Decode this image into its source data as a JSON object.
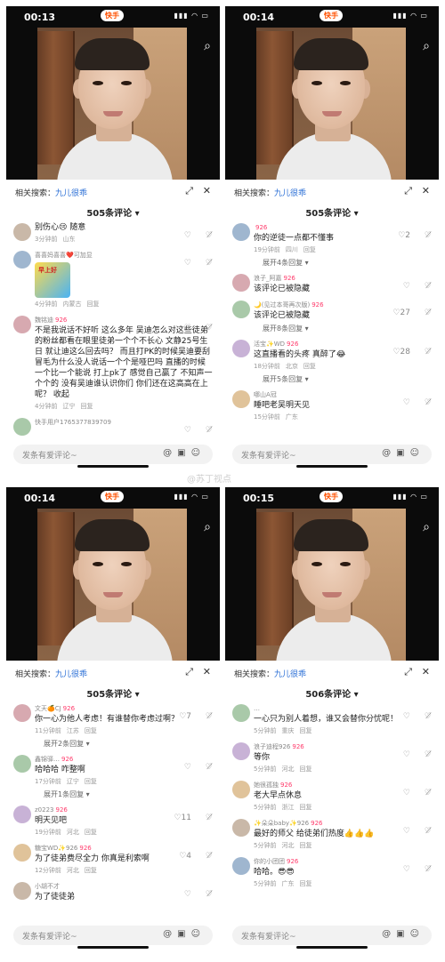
{
  "watermark": "@苏丁视点",
  "panels": [
    {
      "time": "00:13",
      "app": "快手",
      "related_label": "相关搜索：",
      "related_link": "九儿很乖",
      "count": "505条评论 ▾",
      "input_placeholder": "发条有爱评论~",
      "comments": [
        {
          "name": "",
          "badge": "",
          "text": "别伤心😢 随意",
          "meta": [
            "3分钟前",
            "山东"
          ],
          "like": ""
        },
        {
          "name": "喜喜妈喜喜❤️可加显",
          "badge": "",
          "text": "",
          "sticker": "早上好",
          "meta": [
            "4分钟前",
            "内蒙古",
            "回复"
          ],
          "like": ""
        },
        {
          "name": "魏铭迪",
          "badge": "926",
          "text": "不是我说话不好听 这么多年 吴迪怎么对这些徒弟的粉丝都看在眼里徒弟一个个不长心 文静25号生日 就让迪这么回去吗？ 而且打PK的时候吴迪要刮冒毛为什么没人说话一个个是哑巴吗 直播的时候一个比一个能说 打上pk了 感觉自己赢了 不知声一个个的 没有吴迪谁认识你们 你们还在这高高在上呢？ 收起",
          "meta": [
            "4分钟前",
            "辽宁",
            "回复"
          ],
          "like": ""
        },
        {
          "name": "快手用户1765377839709",
          "badge": "",
          "text": "",
          "meta": [],
          "like": ""
        }
      ]
    },
    {
      "time": "00:14",
      "app": "快手",
      "related_label": "相关搜索：",
      "related_link": "九儿很乖",
      "count": "505条评论 ▾",
      "input_placeholder": "发条有爱评论~",
      "comments": [
        {
          "name": "",
          "badge": "926",
          "text": "你的逆徒一点都不懂事",
          "meta": [
            "19分钟前",
            "四川",
            "回复"
          ],
          "like": "2",
          "more": "展开4条回复 ▾"
        },
        {
          "name": "浪子_阿嘉",
          "badge": "926",
          "text": "该评论已被隐藏",
          "meta": [],
          "like": ""
        },
        {
          "name": "🌙(见过本哥再次版)",
          "badge": "926",
          "text": "该评论已被隐藏",
          "meta": [],
          "like": "27",
          "more": "展开8条回复 ▾"
        },
        {
          "name": "活宝✨WD",
          "badge": "926",
          "text": "这直播看的头疼 真醉了😂",
          "meta": [
            "18分钟前",
            "北京",
            "回复"
          ],
          "like": "28",
          "more": "展开5条回复 ▾"
        },
        {
          "name": "哪山A冠",
          "badge": "",
          "text": "睡吧老吴明天见",
          "meta": [
            "15分钟前",
            "广东"
          ],
          "like": ""
        }
      ]
    },
    {
      "time": "00:14",
      "app": "快手",
      "related_label": "相关搜索：",
      "related_link": "九儿很乖",
      "count": "505条评论 ▾",
      "input_placeholder": "发条有爱评论~",
      "comments": [
        {
          "name": "文天🍊CJ",
          "badge": "926",
          "text": "你一心为他人考虑！有谁替你考虑过啊？",
          "meta": [
            "11分钟前",
            "江苏",
            "回复"
          ],
          "like": "7",
          "more": "展开2条回复 ▾"
        },
        {
          "name": "鑫锦驿…",
          "badge": "926",
          "text": "哈哈哈 咋整啊",
          "meta": [
            "17分钟前",
            "辽宁",
            "回复"
          ],
          "like": "",
          "more": "展开1条回复 ▾"
        },
        {
          "name": "z0223",
          "badge": "926",
          "text": "明天见吧",
          "meta": [
            "19分钟前",
            "河北",
            "回复"
          ],
          "like": "11"
        },
        {
          "name": "糖宝WD✨926",
          "badge": "926",
          "text": "为了徒弟费尽全力 你真是利索啊",
          "meta": [
            "12分钟前",
            "河北",
            "回复"
          ],
          "like": "4"
        },
        {
          "name": "小胡不才",
          "badge": "",
          "text": "为了徒徒弟",
          "meta": [],
          "like": ""
        }
      ]
    },
    {
      "time": "00:15",
      "app": "快手",
      "related_label": "相关搜索：",
      "related_link": "九儿很乖",
      "count": "506条评论 ▾",
      "input_placeholder": "发条有爱评论~",
      "comments": [
        {
          "name": "…",
          "badge": "",
          "text": "一心只为别人着想，谁又会替你分忧呢！",
          "meta": [
            "5分钟前",
            "重庆",
            "回复"
          ],
          "like": ""
        },
        {
          "name": "浪子迪程926",
          "badge": "926",
          "text": "等你",
          "meta": [
            "5分钟前",
            "河北",
            "回复"
          ],
          "like": ""
        },
        {
          "name": "她很孤独",
          "badge": "926",
          "text": "老大早点休息",
          "meta": [
            "5分钟前",
            "浙江",
            "回复"
          ],
          "like": ""
        },
        {
          "name": "✨朵朵baby✨926",
          "badge": "926",
          "text": "最好的师父 给徒弟们热度👍👍👍",
          "meta": [
            "5分钟前",
            "河北",
            "回复"
          ],
          "like": ""
        },
        {
          "name": "你的小团团",
          "badge": "926",
          "text": "哈哈。😎😎",
          "meta": [
            "5分钟前",
            "广东",
            "回复"
          ],
          "like": ""
        }
      ]
    }
  ]
}
